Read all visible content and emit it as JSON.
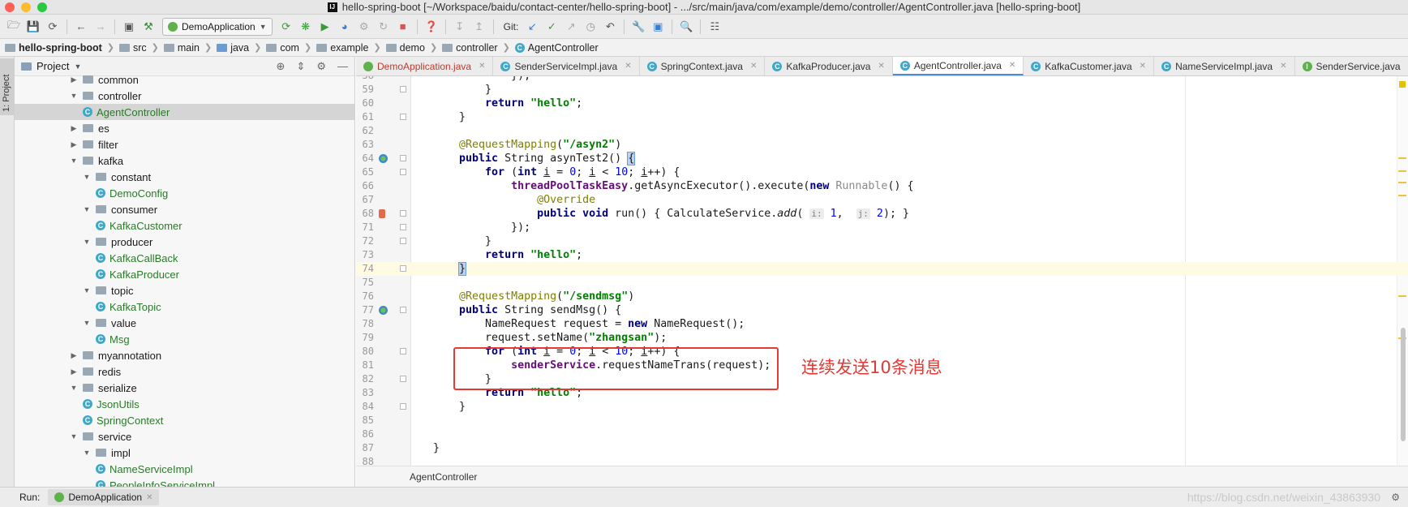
{
  "window": {
    "title": "hello-spring-boot [~/Workspace/baidu/contact-center/hello-spring-boot] - .../src/main/java/com/example/demo/controller/AgentController.java [hello-spring-boot]",
    "traffic_colors": [
      "#fe5f57",
      "#febc2e",
      "#28c840"
    ]
  },
  "toolbar": {
    "run_config": "DemoApplication",
    "git_label": "Git:"
  },
  "breadcrumb": [
    "hello-spring-boot",
    "src",
    "main",
    "java",
    "com",
    "example",
    "demo",
    "controller",
    "AgentController"
  ],
  "left_strip": {
    "label": "1: Project"
  },
  "project_panel": {
    "title": "Project",
    "tree": [
      {
        "label": "common",
        "type": "folder",
        "depth": 1,
        "arrow": "▶"
      },
      {
        "label": "controller",
        "type": "folder",
        "depth": 1,
        "arrow": "▼"
      },
      {
        "label": "AgentController",
        "type": "class",
        "depth": 2,
        "arrow": "",
        "selected": true
      },
      {
        "label": "es",
        "type": "folder",
        "depth": 1,
        "arrow": "▶"
      },
      {
        "label": "filter",
        "type": "folder",
        "depth": 1,
        "arrow": "▶"
      },
      {
        "label": "kafka",
        "type": "folder",
        "depth": 1,
        "arrow": "▼"
      },
      {
        "label": "constant",
        "type": "folder",
        "depth": 2,
        "arrow": "▼"
      },
      {
        "label": "DemoConfig",
        "type": "class",
        "depth": 3,
        "arrow": ""
      },
      {
        "label": "consumer",
        "type": "folder",
        "depth": 2,
        "arrow": "▼"
      },
      {
        "label": "KafkaCustomer",
        "type": "class",
        "depth": 3,
        "arrow": ""
      },
      {
        "label": "producer",
        "type": "folder",
        "depth": 2,
        "arrow": "▼"
      },
      {
        "label": "KafkaCallBack",
        "type": "class",
        "depth": 3,
        "arrow": ""
      },
      {
        "label": "KafkaProducer",
        "type": "class",
        "depth": 3,
        "arrow": ""
      },
      {
        "label": "topic",
        "type": "folder",
        "depth": 2,
        "arrow": "▼"
      },
      {
        "label": "KafkaTopic",
        "type": "class",
        "depth": 3,
        "arrow": ""
      },
      {
        "label": "value",
        "type": "folder",
        "depth": 2,
        "arrow": "▼"
      },
      {
        "label": "Msg",
        "type": "class",
        "depth": 3,
        "arrow": ""
      },
      {
        "label": "myannotation",
        "type": "folder",
        "depth": 1,
        "arrow": "▶"
      },
      {
        "label": "redis",
        "type": "folder",
        "depth": 1,
        "arrow": "▶"
      },
      {
        "label": "serialize",
        "type": "folder",
        "depth": 1,
        "arrow": "▼"
      },
      {
        "label": "JsonUtils",
        "type": "class",
        "depth": 2,
        "arrow": ""
      },
      {
        "label": "SpringContext",
        "type": "class",
        "depth": 2,
        "arrow": ""
      },
      {
        "label": "service",
        "type": "folder",
        "depth": 1,
        "arrow": "▼"
      },
      {
        "label": "impl",
        "type": "folder",
        "depth": 2,
        "arrow": "▼"
      },
      {
        "label": "NameServiceImpl",
        "type": "class",
        "depth": 3,
        "arrow": ""
      },
      {
        "label": "PeopleInfoServiceImpl",
        "type": "class",
        "depth": 3,
        "arrow": ""
      }
    ]
  },
  "editor_tabs": [
    {
      "label": "DemoApplication.java",
      "icon": "app",
      "active": false,
      "red": true
    },
    {
      "label": "SenderServiceImpl.java",
      "icon": "class",
      "active": false
    },
    {
      "label": "SpringContext.java",
      "icon": "class",
      "active": false
    },
    {
      "label": "KafkaProducer.java",
      "icon": "class",
      "active": false
    },
    {
      "label": "AgentController.java",
      "icon": "class",
      "active": true
    },
    {
      "label": "KafkaCustomer.java",
      "icon": "class",
      "active": false
    },
    {
      "label": "NameServiceImpl.java",
      "icon": "class",
      "active": false
    },
    {
      "label": "SenderService.java",
      "icon": "interface",
      "active": false
    }
  ],
  "code": {
    "lines": [
      {
        "n": "58",
        "html": "            });"
      },
      {
        "n": "59",
        "html": "        }"
      },
      {
        "n": "60",
        "html": "        <span class='kw'>return</span> <span class='str'>\"hello\"</span>;"
      },
      {
        "n": "61",
        "html": "    }"
      },
      {
        "n": "62",
        "html": ""
      },
      {
        "n": "63",
        "html": "    <span class='ann'>@RequestMapping</span>(<span class='str'>\"/asyn2\"</span>)"
      },
      {
        "n": "64",
        "html": "    <span class='kw'>public</span> String asynTest2() <span class='brace-hl'>{</span>"
      },
      {
        "n": "65",
        "html": "        <span class='kw'>for</span> (<span class='kw'>int</span> <span class='uline'>i</span> = <span class='num'>0</span>; <span class='uline'>i</span> &lt; <span class='num'>10</span>; <span class='uline'>i</span>++) {"
      },
      {
        "n": "66",
        "html": "            <span class='field'>threadPoolTaskEasy</span>.getAsyncExecutor().execute(<span class='kw'>new</span> <span class='gray'>Runnable</span>() {"
      },
      {
        "n": "67",
        "html": "                <span class='ann'>@Override</span>"
      },
      {
        "n": "68",
        "html": "                <span class='kw'>public void</span> run() { CalculateService.<span class='italic'>add</span>( <span class='hint'>i:</span> <span class='num'>1</span>,  <span class='hint'>j:</span> <span class='num'>2</span>); }"
      },
      {
        "n": "71",
        "html": "            });"
      },
      {
        "n": "72",
        "html": "        }"
      },
      {
        "n": "73",
        "html": "        <span class='kw'>return</span> <span class='str'>\"hello\"</span>;"
      },
      {
        "n": "74",
        "html": "    <span class='brace-hl'>}</span>",
        "current": true
      },
      {
        "n": "75",
        "html": ""
      },
      {
        "n": "76",
        "html": "    <span class='ann'>@RequestMapping</span>(<span class='str'>\"/sendmsg\"</span>)"
      },
      {
        "n": "77",
        "html": "    <span class='kw'>public</span> String sendMsg() {"
      },
      {
        "n": "78",
        "html": "        NameRequest request = <span class='kw'>new</span> NameRequest();"
      },
      {
        "n": "79",
        "html": "        request.setName(<span class='str'>\"zhangsan\"</span>);"
      },
      {
        "n": "80",
        "html": "        <span class='kw'>for</span> (<span class='kw'>int</span> <span class='uline'>i</span> = <span class='num'>0</span>; <span class='uline'>i</span> &lt; <span class='num'>10</span>; <span class='uline'>i</span>++) {"
      },
      {
        "n": "81",
        "html": "            <span class='field'>senderService</span>.requestNameTrans(request);"
      },
      {
        "n": "82",
        "html": "        }"
      },
      {
        "n": "83",
        "html": "        <span class='kw'>return</span> <span class='str'>\"hello\"</span>;"
      },
      {
        "n": "84",
        "html": "    }"
      },
      {
        "n": "85",
        "html": ""
      },
      {
        "n": "86",
        "html": ""
      },
      {
        "n": "87",
        "html": "}"
      },
      {
        "n": "88",
        "html": ""
      }
    ],
    "gutter_icons": {
      "64": "web-mapping",
      "68": "override",
      "77": "web-mapping"
    }
  },
  "annotation": {
    "text": "连续发送10条消息",
    "color": "#e53935"
  },
  "editor_footer": {
    "crumb": "AgentController"
  },
  "runbar": {
    "label": "Run:",
    "tab": "DemoApplication",
    "watermark": "https://blog.csdn.net/weixin_43863930"
  }
}
